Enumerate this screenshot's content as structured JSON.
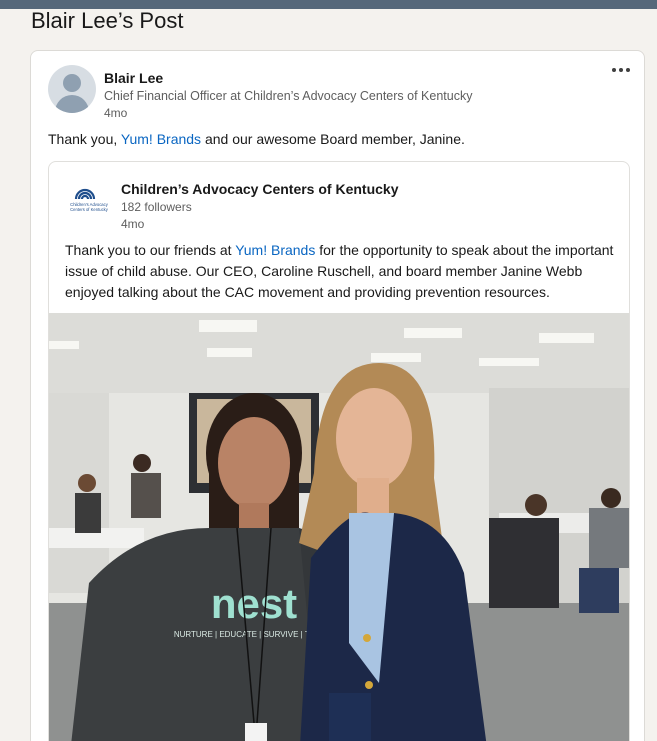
{
  "page": {
    "title": "Blair Lee’s Post"
  },
  "post": {
    "author": {
      "name": "Blair Lee",
      "headline": "Chief Financial Officer at Children’s Advocacy Centers of Kentucky",
      "time": "4mo"
    },
    "text": {
      "prefix": "Thank you, ",
      "link": "Yum! Brands",
      "suffix": " and our awesome Board member, Janine."
    },
    "menu_icon": "more-horizontal-icon"
  },
  "shared_post": {
    "org": {
      "name": "Children’s Advocacy Centers of Kentucky",
      "followers": "182 followers",
      "time": "4mo",
      "logo_text_1": "Children’s Advocacy",
      "logo_text_2": "Centers of Kentucky"
    },
    "text": {
      "prefix": "Thank you to our friends at ",
      "link": "Yum! Brands",
      "suffix": " for the opportunity to speak about the important issue of child abuse. Our CEO, Caroline Ruschell, and board member Janine Webb enjoyed talking about the CAC movement and providing prevention resources."
    },
    "photo": {
      "shirt_text": "nest",
      "shirt_subtext": "NURTURE | EDUCATE | SURVIVE | THRIVE"
    }
  },
  "colors": {
    "link": "#0a66c2",
    "topbar": "#56687a",
    "background": "#f4f2ee"
  }
}
